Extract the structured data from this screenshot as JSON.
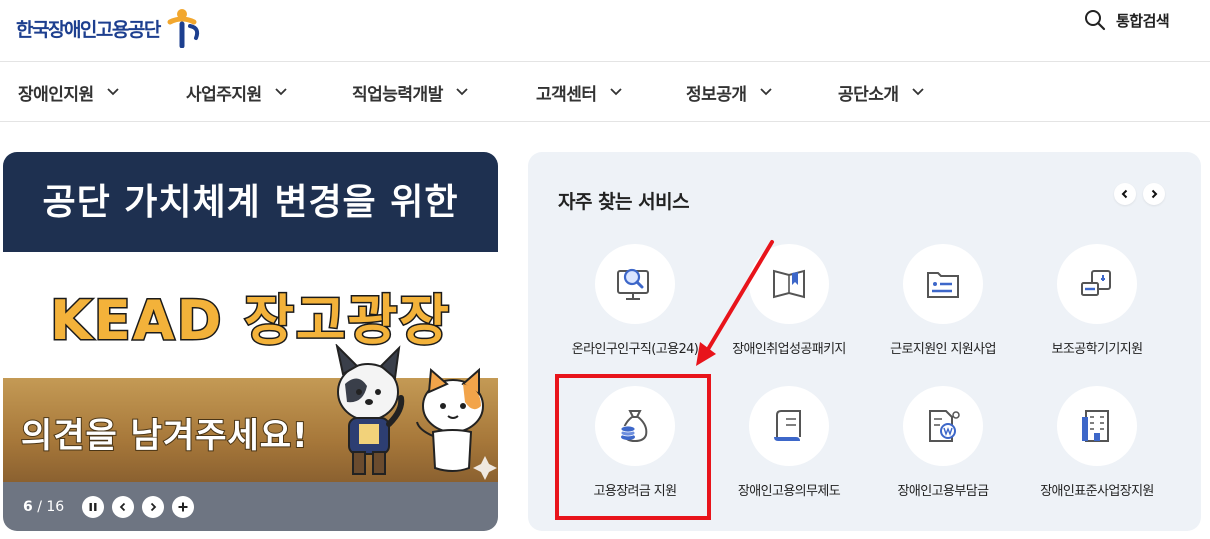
{
  "header": {
    "logo_text": "한국장애인고용공단",
    "search_label": "통합검색"
  },
  "gnb": {
    "items": [
      {
        "label": "장애인지원"
      },
      {
        "label": "사업주지원"
      },
      {
        "label": "직업능력개발"
      },
      {
        "label": "고객센터"
      },
      {
        "label": "정보공개"
      },
      {
        "label": "공단소개"
      }
    ]
  },
  "banner": {
    "top_text": "공단 가치체계 변경을 위한",
    "main_text": "KEAD 장고광장",
    "sub_text": "의견을 남겨주세요!",
    "counter_current": "6",
    "counter_sep": " / ",
    "counter_total": "16",
    "colors": {
      "top_bg": "#1e3050",
      "main_text": "#f3b23a",
      "control_bg": "#6e7582"
    }
  },
  "services": {
    "title": "자주 찾는 서비스",
    "items": [
      {
        "label": "온라인구인구직(고용24)",
        "icon": "monitor-search-icon"
      },
      {
        "label": "장애인취업성공패키지",
        "icon": "book-bookmark-icon"
      },
      {
        "label": "근로지원인 지원사업",
        "icon": "id-folder-icon"
      },
      {
        "label": "보조공학기기지원",
        "icon": "assistive-device-icon"
      },
      {
        "label": "고용장려금 지원",
        "icon": "money-bag-icon"
      },
      {
        "label": "장애인고용의무제도",
        "icon": "scroll-document-icon"
      },
      {
        "label": "장애인고용부담금",
        "icon": "document-won-icon"
      },
      {
        "label": "장애인표준사업장지원",
        "icon": "building-icon"
      }
    ],
    "highlighted_item": "고용장려금 지원",
    "colors": {
      "panel_bg": "#eef2f7",
      "icon_blue": "#3d67c9",
      "highlight": "#e8141b"
    }
  }
}
